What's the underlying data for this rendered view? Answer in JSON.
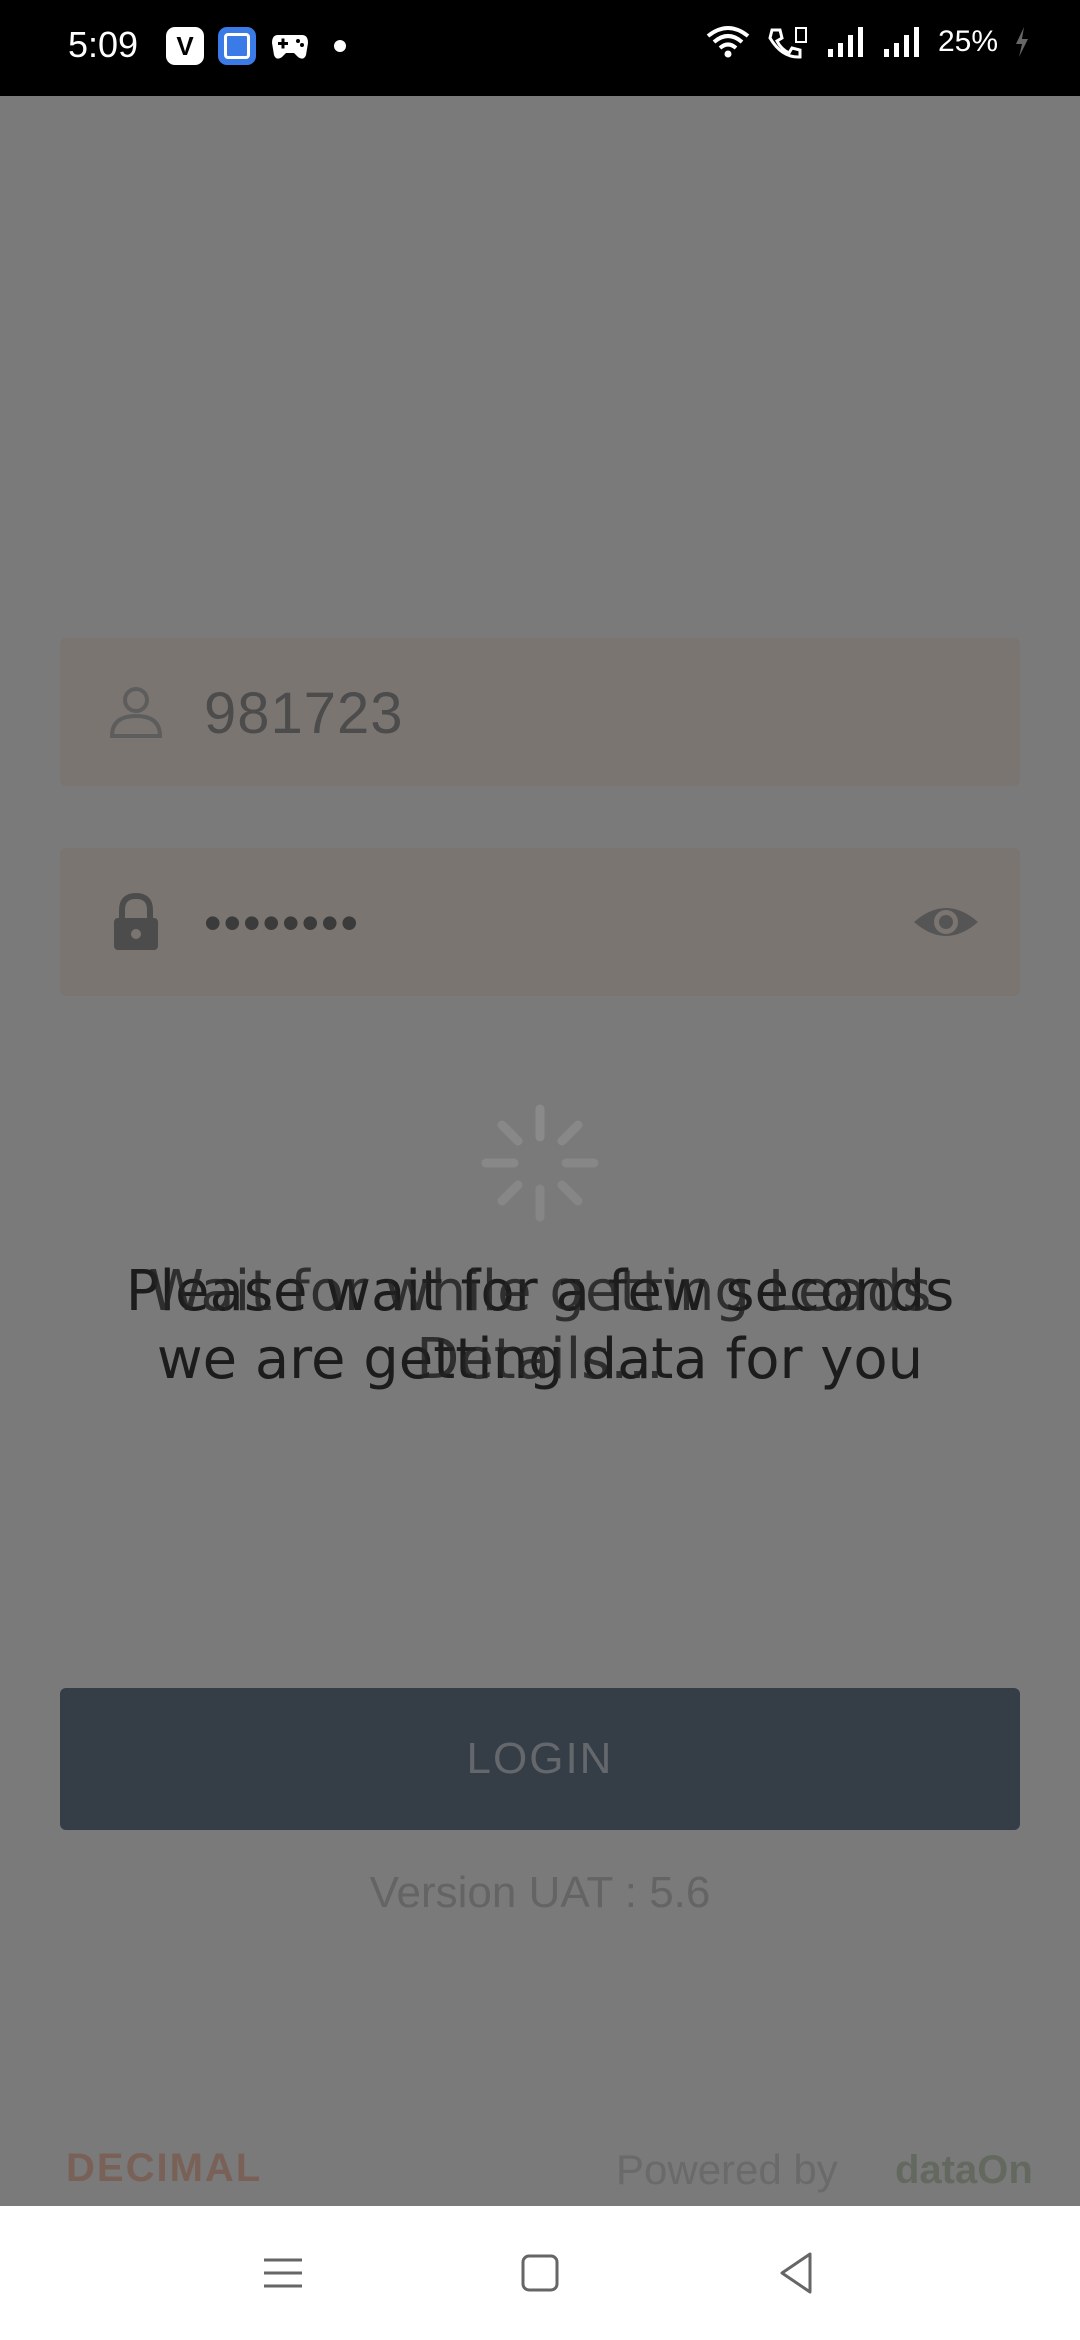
{
  "status_bar": {
    "time": "5:09",
    "battery": "25%"
  },
  "login_form": {
    "username_value": "981723",
    "password_value": "••••••••",
    "login_label": "LOGIN"
  },
  "version_text": "Version UAT : 5.6",
  "footer": {
    "left_logo": "DECIMAL",
    "powered_by": "Powered by",
    "brand": "dataOn"
  },
  "loading_overlay": {
    "line1": "Please wait for a few seconds",
    "line2": "we are getting data for you",
    "overlap_text_1": "Wait for while getting Leads",
    "overlap_text_2": "Details..."
  },
  "colors": {
    "overlay": "#000000",
    "login_button": "#6b7a8f",
    "field_bg": "#f7ebe3"
  }
}
